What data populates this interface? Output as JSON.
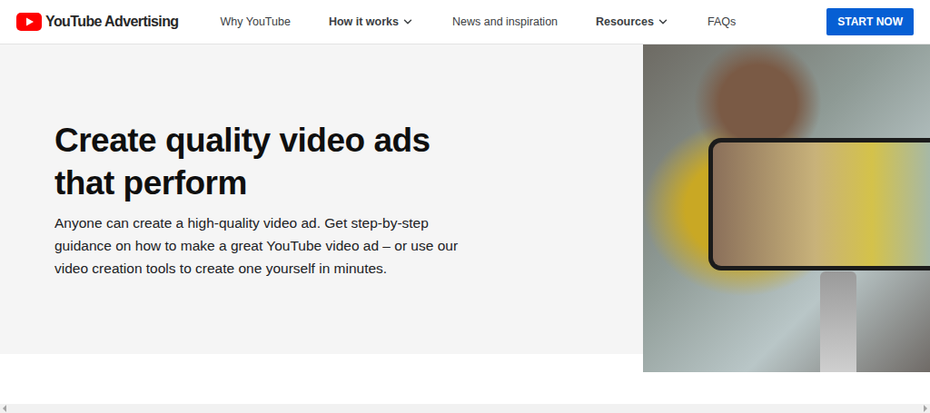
{
  "header": {
    "logo": "YouTube Advertising",
    "nav": [
      {
        "label": "Why YouTube",
        "has_menu": false
      },
      {
        "label": "How it works",
        "has_menu": true
      },
      {
        "label": "News and inspiration",
        "has_menu": false
      },
      {
        "label": "Resources",
        "has_menu": true
      },
      {
        "label": "FAQs",
        "has_menu": false
      }
    ],
    "cta": "START NOW"
  },
  "hero": {
    "title": "Create quality video ads that perform",
    "body": "Anyone can create a high-quality video ad. Get step-by-step guidance on how to make a great YouTube video ad – or use our video creation tools to create one yourself in minutes."
  }
}
